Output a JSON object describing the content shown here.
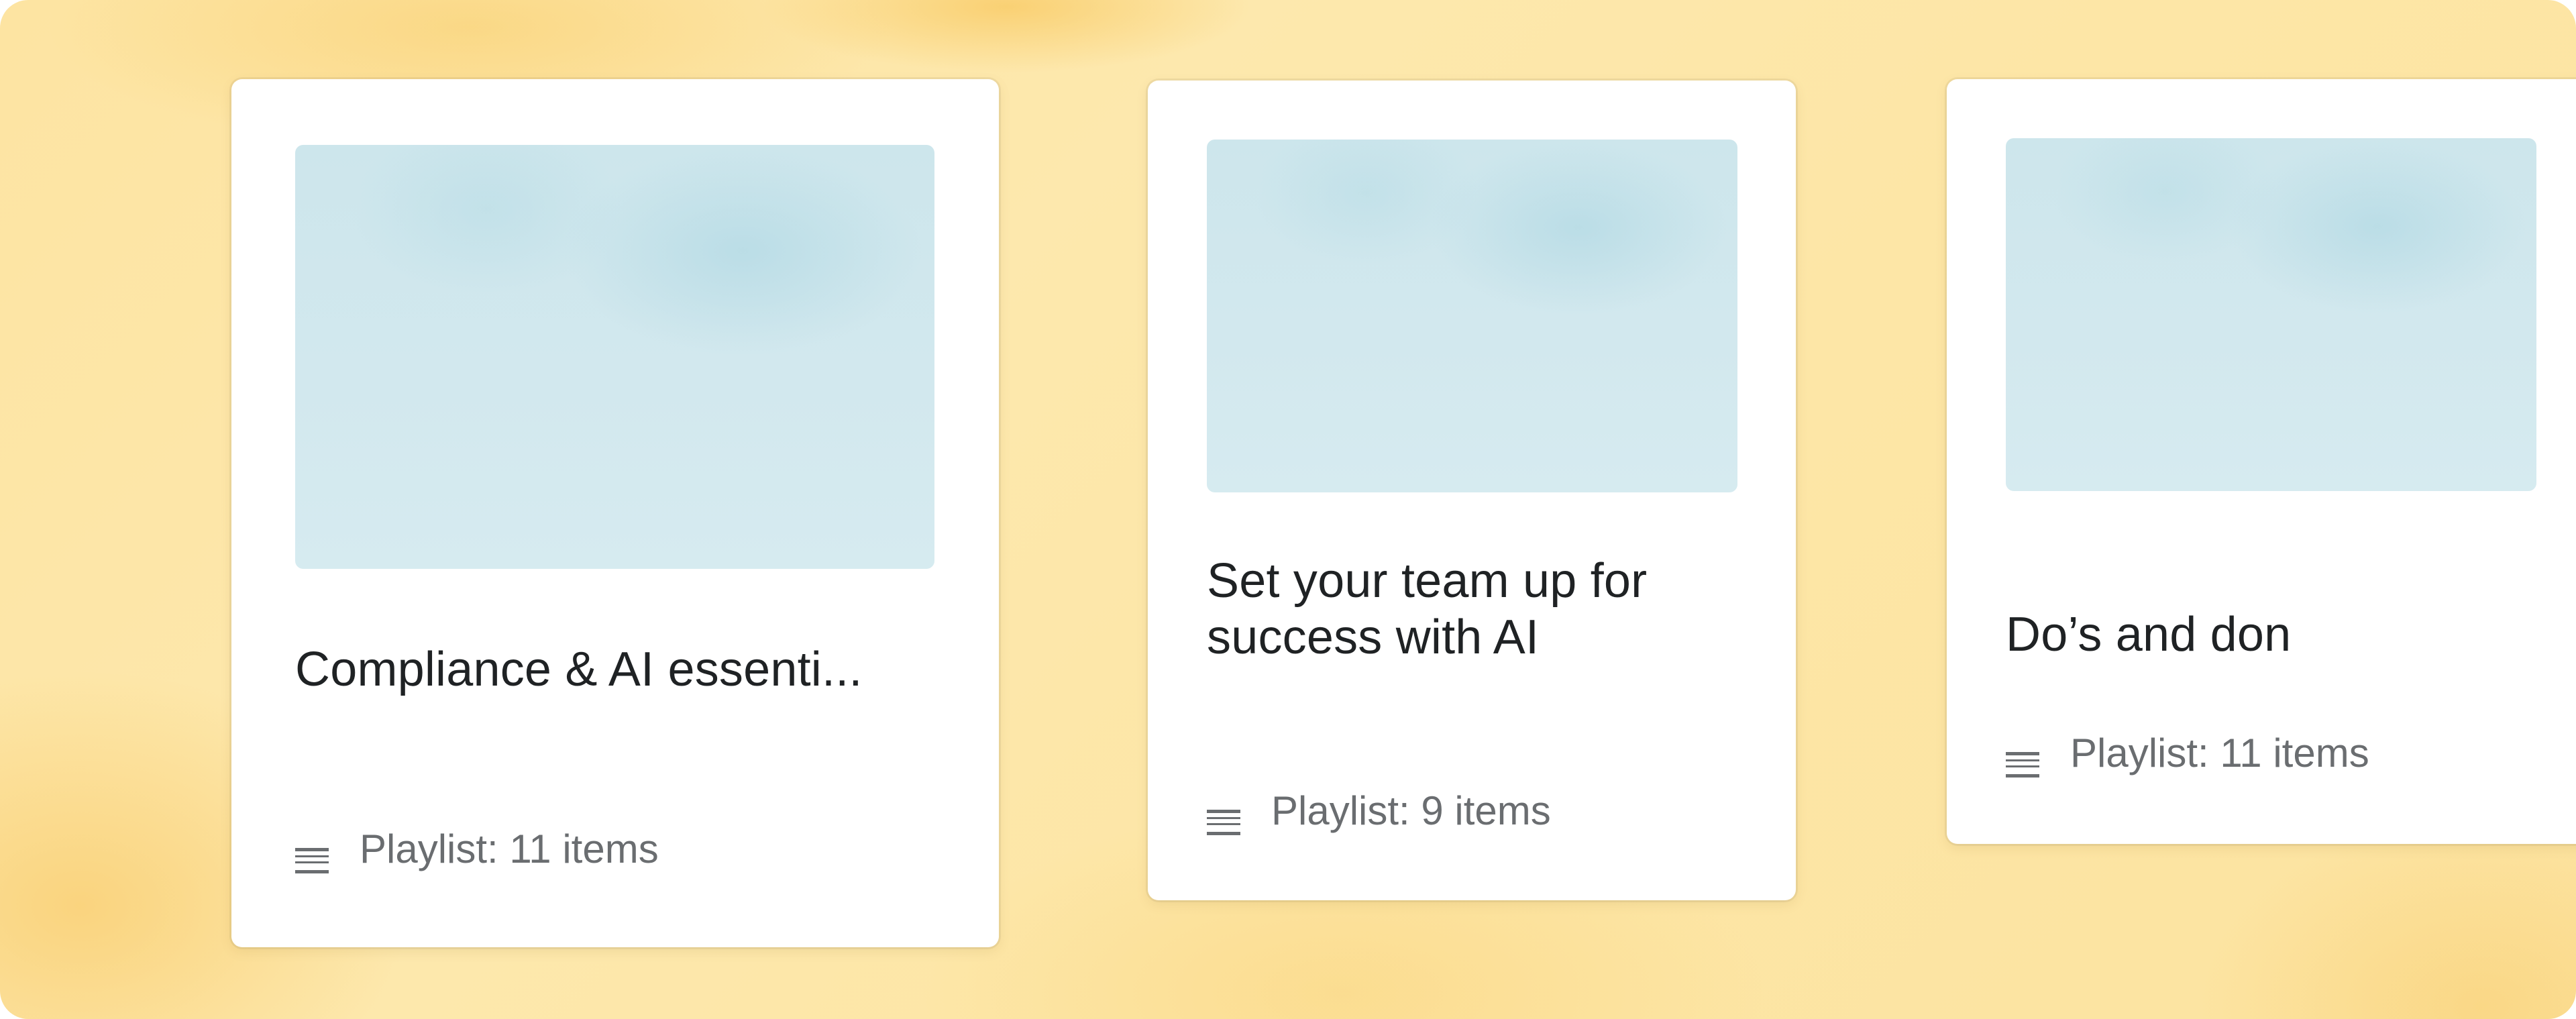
{
  "cards": [
    {
      "title": "Compliance & AI essenti...",
      "meta_label": "Playlist: 11 items",
      "meta_icon": "playlist-icon"
    },
    {
      "title": "Set your team up for success with AI",
      "meta_label": "Playlist: 9 items",
      "meta_icon": "playlist-icon"
    },
    {
      "title": "Do’s and don",
      "meta_label": "Playlist: 11 items",
      "meta_icon": "playlist-icon"
    }
  ],
  "colors": {
    "background": "#fde6a6",
    "card": "#ffffff",
    "thumbnail": "#d2e8ee",
    "title_text": "#1f2224",
    "meta_text": "#6a6d70"
  }
}
